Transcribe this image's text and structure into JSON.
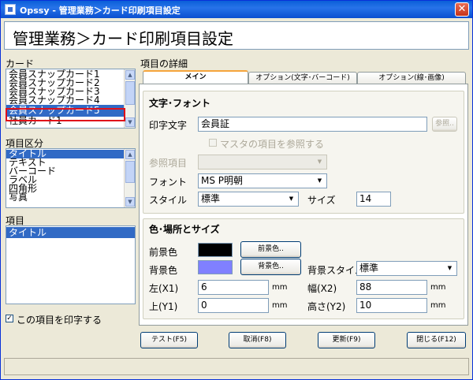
{
  "window": {
    "title": "Opssy - 管理業務＞カード印刷項目設定",
    "close_label": "✕"
  },
  "header": {
    "title": "管理業務＞カード印刷項目設定"
  },
  "card_section": {
    "label": "カード",
    "items": [
      "会員スナップカード1",
      "会員スナップカード2",
      "会員スナップカード3",
      "会員スナップカード4",
      "会員スナップカード5",
      "社員カード1"
    ],
    "selected_index": 4
  },
  "category_section": {
    "label": "項目区分",
    "items": [
      "タイトル",
      "テキスト",
      "バーコード",
      "ラベル",
      "四角形",
      "写真"
    ],
    "selected_index": 0
  },
  "item_section": {
    "label": "項目",
    "items": [
      "タイトル"
    ],
    "selected_index": 0
  },
  "print_checkbox": {
    "checked": true,
    "mark": "✓",
    "label": "この項目を印字する"
  },
  "details": {
    "label": "項目の詳細",
    "tabs": [
      {
        "label": "メイン",
        "active": true
      },
      {
        "label": "オプション(文字･バーコード)",
        "active": false
      },
      {
        "label": "オプション(線･画像)",
        "active": false
      }
    ],
    "text_font": {
      "title": "文字･フォント",
      "print_text_label": "印字文字",
      "print_text_value": "会員証",
      "ref_button": "参照..",
      "master_ref_label": "マスタの項目を参照する",
      "ref_item_label": "参照項目",
      "ref_item_value": "",
      "font_label": "フォント",
      "font_value": "MS P明朝",
      "style_label": "スタイル",
      "style_value": "標準",
      "size_label": "サイズ",
      "size_value": "14"
    },
    "color_position": {
      "title": "色･場所とサイズ",
      "fg_label": "前景色",
      "fg_color": "#000000",
      "fg_button": "前景色..",
      "bg_label": "背景色",
      "bg_color": "#8080ff",
      "bg_button": "背景色..",
      "bg_style_label": "背景スタイル",
      "bg_style_value": "標準",
      "left_label": "左(X1)",
      "left_value": "6",
      "top_label": "上(Y1)",
      "top_value": "0",
      "width_label": "幅(X2)",
      "width_value": "88",
      "height_label": "高さ(Y2)",
      "height_value": "10",
      "unit": "mm"
    }
  },
  "footer_buttons": {
    "test": "テスト(F5)",
    "cancel": "取消(F8)",
    "update": "更新(F9)",
    "close": "閉じる(F12)"
  },
  "icons": {
    "dropdown": "▼",
    "scroll_up": "▲",
    "scroll_down": "▼"
  }
}
